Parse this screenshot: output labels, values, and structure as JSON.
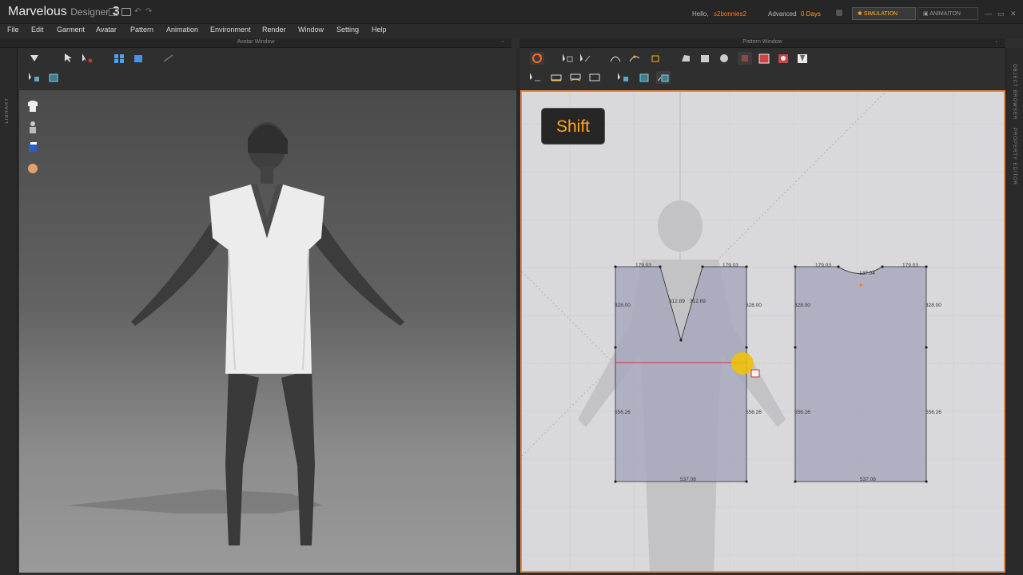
{
  "app": {
    "brand_main": "Marvelous",
    "brand_sub": "Designer",
    "brand_version": "3",
    "hello": "Hello,",
    "username": "s2bonnies2",
    "plan": "Advanced",
    "days": "0 Days",
    "mode_simulation": "SIMULATION",
    "mode_animation": "ANIMAITON"
  },
  "menu": [
    "File",
    "Edit",
    "Garment",
    "Avatar",
    "Pattern",
    "Animation",
    "Environment",
    "Render",
    "Window",
    "Setting",
    "Help"
  ],
  "windows": {
    "avatar_title": "Avatar Window",
    "pattern_title": "Pattern Window"
  },
  "side_tabs": {
    "library": "LIBRARY",
    "object_browser": "OBJECT BROWSER",
    "property_editor": "PROPERTY EDITOR"
  },
  "key_overlay": "Shift",
  "pattern_measurements": {
    "front_top_left": "179.03",
    "front_top_right": "179.03",
    "front_neck_left": "312.89",
    "front_neck_right": "312.89",
    "front_side_left_upper": "328.00",
    "front_side_right_upper": "328.00",
    "front_side_left_lower": "556.26",
    "front_side_right_lower": "556.26",
    "front_bottom": "537.08",
    "back_top_left": "179.03",
    "back_top_right": "179.03",
    "back_neck": "137.04",
    "back_side_left_upper": "328.00",
    "back_side_right_upper": "328.00",
    "back_side_left_lower": "556.26",
    "back_side_right_lower": "556.26",
    "back_bottom": "537.08"
  },
  "colors": {
    "accent": "#ff7a1a",
    "pattern_fill": "#a7a9bd",
    "viewport_border": "#e0894b"
  }
}
